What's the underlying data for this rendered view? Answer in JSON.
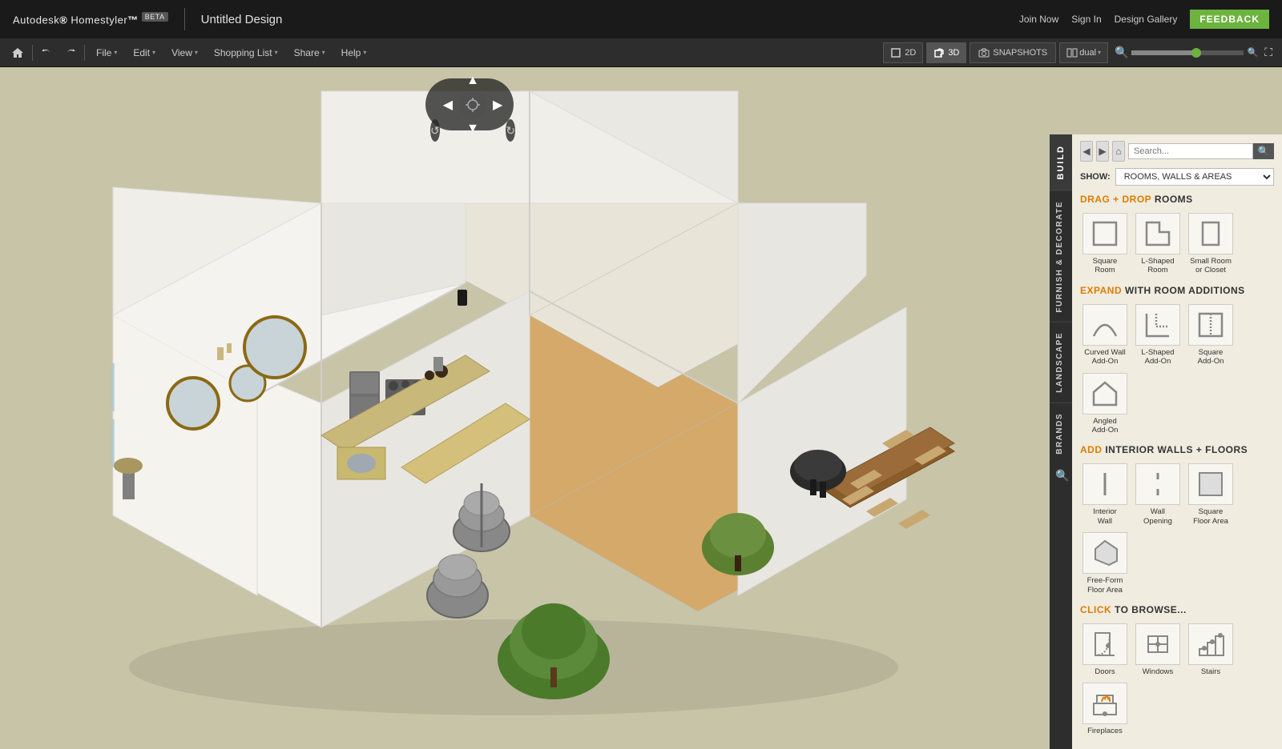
{
  "app": {
    "name": "Autodesk",
    "product": "Homestyler",
    "beta": "BETA",
    "title": "Untitled Design"
  },
  "topbar": {
    "links": [
      "Join Now",
      "Sign In",
      "Design Gallery"
    ],
    "feedback": "FEEDBACK"
  },
  "menubar": {
    "icons": [
      "home",
      "undo",
      "redo"
    ],
    "menus": [
      {
        "label": "File",
        "arrow": "▾"
      },
      {
        "label": "Edit",
        "arrow": "▾"
      },
      {
        "label": "View",
        "arrow": "▾"
      },
      {
        "label": "Shopping List",
        "arrow": "▾"
      },
      {
        "label": "Share",
        "arrow": "▾"
      },
      {
        "label": "Help",
        "arrow": "▾"
      }
    ],
    "view2d": "2D",
    "view3d": "3D",
    "snapshots": "SNAPSHOTS",
    "dual": "dual"
  },
  "sidetabs": {
    "tabs": [
      "BUILD",
      "FURNISH & DECORATE",
      "LANDSCAPE",
      "BRANDS"
    ]
  },
  "panel": {
    "show_label": "SHOW:",
    "show_options": [
      "ROOMS, WALLS & AREAS"
    ],
    "sections": {
      "drag_rooms": {
        "label_highlight": "DRAG + DROP",
        "label_normal": " ROOMS",
        "items": [
          {
            "label": "Square\nRoom",
            "icon": "square-room"
          },
          {
            "label": "L-Shaped\nRoom",
            "icon": "l-room"
          },
          {
            "label": "Small Room\nor Closet",
            "icon": "small-room"
          }
        ]
      },
      "expand_rooms": {
        "label_highlight": "EXPAND",
        "label_normal": " WITH ROOM ADDITIONS",
        "items": [
          {
            "label": "Curved Wall\nAdd-On",
            "icon": "curved-wall"
          },
          {
            "label": "L-Shaped\nAdd-On",
            "icon": "l-add"
          },
          {
            "label": "Square\nAdd-On",
            "icon": "square-add"
          },
          {
            "label": "Angled\nAdd-On",
            "icon": "angled-add"
          }
        ]
      },
      "interior_walls": {
        "label_highlight": "ADD",
        "label_normal": " INTERIOR WALLS + FLOORS",
        "items": [
          {
            "label": "Interior\nWall",
            "icon": "interior-wall"
          },
          {
            "label": "Wall\nOpening",
            "icon": "wall-opening"
          },
          {
            "label": "Square\nFloor Area",
            "icon": "square-floor"
          },
          {
            "label": "Free-Form\nFloor Area",
            "icon": "freeform-floor"
          }
        ]
      },
      "click_browse": {
        "label_highlight": "CLICK",
        "label_normal": " TO BROWSE...",
        "items": [
          {
            "label": "Doors",
            "icon": "doors"
          },
          {
            "label": "Windows",
            "icon": "windows"
          },
          {
            "label": "Stairs",
            "icon": "stairs"
          },
          {
            "label": "Fireplaces",
            "icon": "fireplaces"
          }
        ]
      }
    }
  }
}
